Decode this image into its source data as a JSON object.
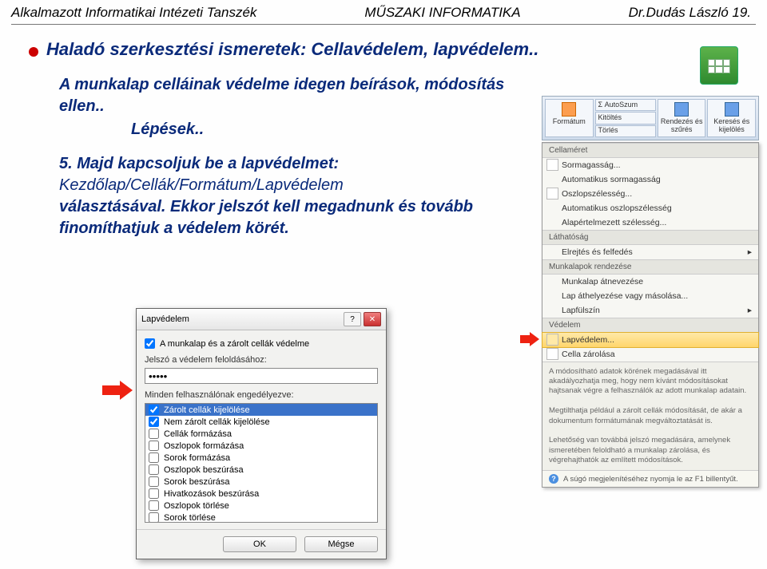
{
  "header": {
    "left": "Alkalmazott Informatikai Intézeti Tanszék",
    "center": "MŰSZAKI INFORMATIKA",
    "right": "Dr.Dudás László     19."
  },
  "title": "Haladó szerkesztési ismeretek: Cellavédelem, lapvédelem..",
  "sub_line1": "A munkalap celláinak védelme idegen beírások, módosítás ellen..",
  "sub_steps": "Lépések..",
  "step5_num": "5.",
  "step5_a": "Majd kapcsoljuk be a lapvédelmet:",
  "step5_path": "Kezdőlap/Cellák/Formátum/Lapvédelem",
  "step5_b": "választásával. Ekkor jelszót kell megadnunk és tovább finomíthatjuk a védelem körét.",
  "ribbon": {
    "buttons": [
      "Formátum",
      "Σ  AutoSzum",
      "Kitöltés",
      "Törlés",
      "Rendezés és szűrés",
      "Keresés és kijelölés"
    ],
    "sections": {
      "cellameret": "Cellaméret",
      "items1": [
        "Sormagasság...",
        "Automatikus sormagasság",
        "Oszlopszélesség...",
        "Automatikus oszlopszélesség",
        "Alapértelmezett szélesség..."
      ],
      "lathatosag": "Láthatóság",
      "items2": [
        "Elrejtés és felfedés"
      ],
      "rendezes": "Munkalapok rendezése",
      "items3": [
        "Munkalap átnevezése",
        "Lap áthelyezése vagy másolása...",
        "Lapfülszín"
      ],
      "vedelem": "Védelem",
      "items4": [
        "Lapvédelem...",
        "Cella zárolása"
      ],
      "desc": "A módosítható adatok körének megadásával itt akadályozhatja meg, hogy nem kívánt módosításokat hajtsanak végre a felhasználók az adott munkalap adatain.\n\nMegtilthatja például a zárolt cellák módosítását, de akár a dokumentum formátumának megváltoztatását is.\n\nLehetőség van továbbá jelszó megadására, amelynek ismeretében feloldható a munkalap zárolása, és végrehajthatók az említett módosítások.",
      "footer": "A súgó megjelenítéséhez nyomja le az F1 billentyűt."
    }
  },
  "dialog": {
    "title": "Lapvédelem",
    "cb1": "A munkalap és a zárolt cellák védelme",
    "pw_label": "Jelszó a védelem feloldásához:",
    "pw_value": "•••••",
    "allow_label": "Minden felhasználónak engedélyezve:",
    "options": [
      {
        "label": "Zárolt cellák kijelölése",
        "checked": true,
        "selected": true
      },
      {
        "label": "Nem zárolt cellák kijelölése",
        "checked": true
      },
      {
        "label": "Cellák formázása",
        "checked": false
      },
      {
        "label": "Oszlopok formázása",
        "checked": false
      },
      {
        "label": "Sorok formázása",
        "checked": false
      },
      {
        "label": "Oszlopok beszúrása",
        "checked": false
      },
      {
        "label": "Sorok beszúrása",
        "checked": false
      },
      {
        "label": "Hivatkozások beszúrása",
        "checked": false
      },
      {
        "label": "Oszlopok törlése",
        "checked": false
      },
      {
        "label": "Sorok törlése",
        "checked": false
      }
    ],
    "ok": "OK",
    "cancel": "Mégse"
  }
}
